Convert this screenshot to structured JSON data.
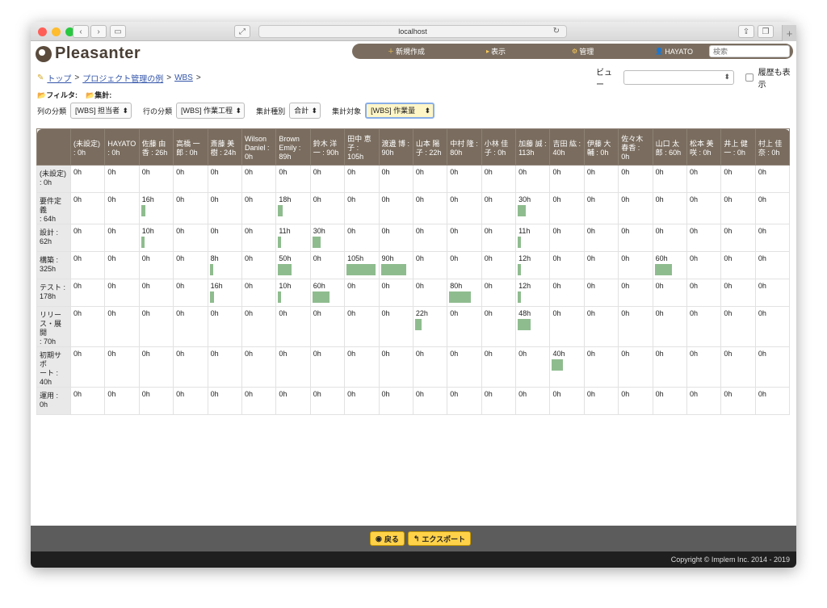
{
  "browser": {
    "url": "localhost",
    "reload_icon": "reload-icon",
    "traffic_colors": [
      "#ff5f57",
      "#febc2e",
      "#28c840"
    ]
  },
  "app": {
    "logo_text": "Pleasanter",
    "nav": {
      "new_label": "新規作成",
      "view_label": "表示",
      "admin_label": "管理",
      "user_label": "HAYATO",
      "search_placeholder": "検索"
    }
  },
  "breadcrumb": {
    "top": "トップ",
    "sep": ">",
    "project": "プロジェクト管理の例",
    "wbs": "WBS"
  },
  "view": {
    "label": "ビュー",
    "selected": "",
    "history_label": "履歴も表示"
  },
  "filters": {
    "filter_label": "フィルタ:",
    "aggregate_label": "集計:"
  },
  "options": {
    "column_label": "列の分類",
    "column_value": "[WBS] 担当者",
    "row_label": "行の分類",
    "row_value": "[WBS] 作業工程",
    "agg_type_label": "集計種別",
    "agg_type_value": "合計",
    "agg_target_label": "集計対象",
    "agg_target_value": "[WBS] 作業量"
  },
  "grid": {
    "columns": [
      "(未設定)\n: 0h",
      "HAYATO\n: 0h",
      "佐藤 由\n香 : 26h",
      "高橋 一\n郎 : 0h",
      "斎藤 美\n樹 : 24h",
      "Wilson\nDaniel :\n0h",
      "Brown\nEmily :\n89h",
      "鈴木 洋\n一 : 90h",
      "田中 恵\n子 :\n105h",
      "渡邊 博 :\n90h",
      "山本 陽\n子 : 22h",
      "中村 隆 :\n80h",
      "小林 佳\n子 : 0h",
      "加藤 誠 :\n113h",
      "吉田 紘 :\n40h",
      "伊藤 大\n輔 : 0h",
      "佐々木\n春香 :\n0h",
      "山口 太\n郎 : 60h",
      "松本 美\n咲 : 0h",
      "井上 健\n一 : 0h",
      "村上 佳\n奈 : 0h"
    ],
    "rows": [
      {
        "label": "(未設定)\n: 0h",
        "values": [
          0,
          0,
          0,
          0,
          0,
          0,
          0,
          0,
          0,
          0,
          0,
          0,
          0,
          0,
          0,
          0,
          0,
          0,
          0,
          0,
          0
        ]
      },
      {
        "label": "要件定義\n: 64h",
        "values": [
          0,
          0,
          16,
          0,
          0,
          0,
          18,
          0,
          0,
          0,
          0,
          0,
          0,
          30,
          0,
          0,
          0,
          0,
          0,
          0,
          0
        ]
      },
      {
        "label": "設計 :\n62h",
        "values": [
          0,
          0,
          10,
          0,
          0,
          0,
          11,
          30,
          0,
          0,
          0,
          0,
          0,
          11,
          0,
          0,
          0,
          0,
          0,
          0,
          0
        ]
      },
      {
        "label": "構築 :\n325h",
        "values": [
          0,
          0,
          0,
          0,
          8,
          0,
          50,
          0,
          105,
          90,
          0,
          0,
          0,
          12,
          0,
          0,
          0,
          60,
          0,
          0,
          0
        ]
      },
      {
        "label": "テスト :\n178h",
        "values": [
          0,
          0,
          0,
          0,
          16,
          0,
          10,
          60,
          0,
          0,
          0,
          80,
          0,
          12,
          0,
          0,
          0,
          0,
          0,
          0,
          0
        ]
      },
      {
        "label": "リリー\nス・展開\n: 70h",
        "values": [
          0,
          0,
          0,
          0,
          0,
          0,
          0,
          0,
          0,
          0,
          22,
          0,
          0,
          48,
          0,
          0,
          0,
          0,
          0,
          0,
          0
        ]
      },
      {
        "label": "初期サポ\nート :\n40h",
        "values": [
          0,
          0,
          0,
          0,
          0,
          0,
          0,
          0,
          0,
          0,
          0,
          0,
          0,
          0,
          40,
          0,
          0,
          0,
          0,
          0,
          0
        ]
      },
      {
        "label": "運用 :\n0h",
        "values": [
          0,
          0,
          0,
          0,
          0,
          0,
          0,
          0,
          0,
          0,
          0,
          0,
          0,
          0,
          0,
          0,
          0,
          0,
          0,
          0,
          0
        ]
      }
    ],
    "unit": "h",
    "bar_max": 105,
    "bar_color": "#8fbc8f"
  },
  "footer": {
    "back_label": "戻る",
    "export_label": "エクスポート",
    "copyright": "Copyright © Implem Inc. 2014 - 2019"
  }
}
